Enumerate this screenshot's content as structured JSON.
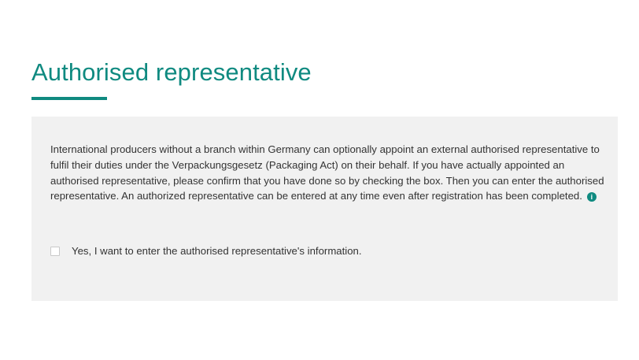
{
  "section": {
    "title": "Authorised representative",
    "accent_color": "#0f8a80"
  },
  "panel": {
    "description": "International producers without a branch within Germany can optionally appoint an external authorised representative to fulfil their duties under the Verpackungsgesetz (Packaging Act) on their behalf. If you have actually appointed an authorised representative, please confirm that you have done so by checking the box. Then you can enter the authorised representative. An authorized representative can be entered at any time even after registration has been completed.",
    "info_icon": {
      "name": "info-icon",
      "glyph": "i"
    },
    "checkbox": {
      "label": "Yes, I want to enter the authorised representative's information.",
      "checked": false
    }
  }
}
